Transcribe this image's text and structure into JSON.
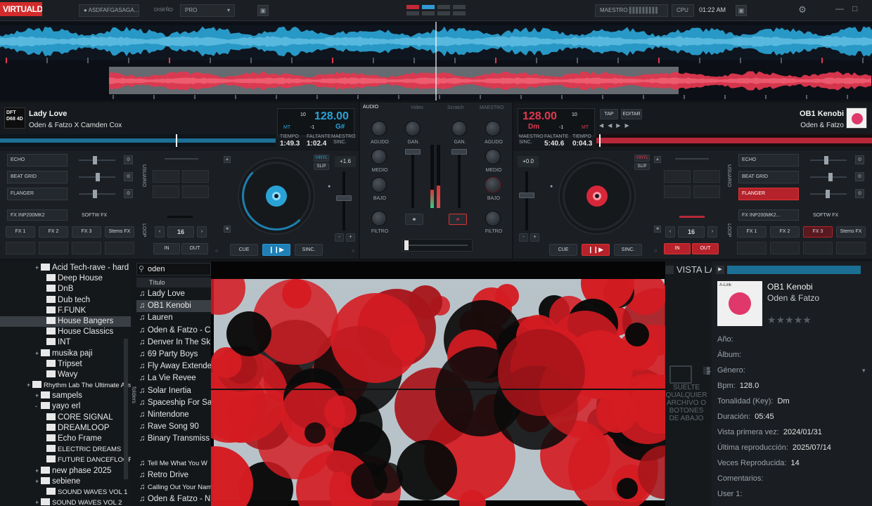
{
  "topbar": {
    "logo": "VIRTUALDJ",
    "user": "ASDFAFGASAGA...",
    "design_label": "DISEÑO",
    "design_value": "PRO",
    "master_label": "MAESTRO",
    "cpu_label": "CPU",
    "clock": "01:22 AM"
  },
  "deck_left": {
    "title": "Lady Love",
    "artist": "Oden & Fatzo X Camden Cox",
    "art_text": "DFT D68 4D",
    "key_num": "10",
    "bpm": "128.00",
    "key": "G#",
    "mt": "MT",
    "pitch_offset": "-1",
    "time_label": "TIEMPO",
    "remaining_label": "FALTANTE",
    "master_label": "MAESTRO",
    "elapsed": "1:49.3",
    "remaining": "1:02.4",
    "sync_label": "SINC.",
    "fx": [
      "ECHO",
      "BEAT GRID",
      "FLANGER"
    ],
    "fx_device": "FX INP200MK2",
    "softw_fx": "SOFTW FX",
    "fx_buttons": [
      "FX 1",
      "FX 2",
      "FX 3",
      "Stems FX"
    ],
    "loop_size": "16",
    "in_label": "IN",
    "out_label": "OUT",
    "cue": "CUE",
    "sync": "SINC.",
    "vinyl": "VINYL",
    "slip": "SLIP",
    "pitch": "+1.6",
    "pad_label": "USUARIO",
    "loop_label": "LOOP"
  },
  "deck_right": {
    "title": "OB1 Kenobi",
    "artist": "Oden & Fatzo",
    "key_num": "10",
    "bpm": "128.00",
    "key": "Dm",
    "mt": "MT",
    "pitch_offset": "-1",
    "time_label": "TIEMPO",
    "remaining_label": "FALTANTE",
    "master_label": "MAESTRO",
    "elapsed": "0:04.3",
    "remaining": "5:40.6",
    "sync_label": "SINC.",
    "tap": "TAP",
    "edit": "EDITAR",
    "fx": [
      "ECHO",
      "BEAT GRID",
      "FLANGER"
    ],
    "fx_device": "FX INP200MK2...",
    "softw_fx": "SOFTW FX",
    "fx_buttons": [
      "FX 1",
      "FX 2",
      "FX 3",
      "Stems FX"
    ],
    "loop_size": "16",
    "in_label": "IN",
    "out_label": "OUT",
    "cue": "CUE",
    "sync": "SINC.",
    "vinyl": "VINYL",
    "slip": "SLIP",
    "pitch": "+0.0",
    "pad_label": "USUARIO",
    "loop_label": "LOOP"
  },
  "mixer": {
    "tabs": [
      "AUDIO",
      "Video",
      "Scratch",
      "MAESTRO"
    ],
    "left_eq": [
      "AGUDO",
      "MEDIO",
      "BAJO",
      "FILTRO"
    ],
    "right_eq": [
      "AGUDO",
      "MEDIO",
      "BAJO",
      "FILTRO"
    ],
    "gain": "GAN."
  },
  "browser": {
    "folders": [
      {
        "name": "Acid Tech-rave - hard",
        "exp": "+"
      },
      {
        "name": "Deep House",
        "exp": ""
      },
      {
        "name": "DnB",
        "exp": ""
      },
      {
        "name": "Dub tech",
        "exp": ""
      },
      {
        "name": "F.FUNK",
        "exp": ""
      },
      {
        "name": "House Bangers",
        "exp": "",
        "selected": true
      },
      {
        "name": "House Classics",
        "exp": ""
      },
      {
        "name": "INT",
        "exp": ""
      },
      {
        "name": "musika paji",
        "exp": "+"
      },
      {
        "name": "Tripset",
        "exp": ""
      },
      {
        "name": "Wavy",
        "exp": ""
      },
      {
        "name": "Rhythm Lab The Ultimate Am",
        "exp": "+",
        "small": true
      },
      {
        "name": "sampels",
        "exp": "+"
      },
      {
        "name": "yayo erl",
        "exp": "-"
      },
      {
        "name": "CORE SIGNAL",
        "exp": ""
      },
      {
        "name": "DREAMLOOP",
        "exp": ""
      },
      {
        "name": "Echo Frame",
        "exp": ""
      },
      {
        "name": "ELECTRIC DREAMS",
        "exp": "",
        "small": true
      },
      {
        "name": "FUTURE DANCEFLOOR",
        "exp": "",
        "small": true
      },
      {
        "name": "new phase 2025",
        "exp": "+"
      },
      {
        "name": "sebiene",
        "exp": "+"
      },
      {
        "name": "SOUND WAVES VOL 1",
        "exp": "",
        "small": true
      },
      {
        "name": "SOUND WAVES VOL 2",
        "exp": "+",
        "small": true
      }
    ],
    "search": "oden",
    "column_title": "Título",
    "folders_tab": "folders",
    "tracks": [
      "Lady Love",
      "OB1 Kenobi",
      "Lauren",
      "Oden & Fatzo - C",
      "Denver In The Sk",
      "69 Party Boys",
      "Fly Away Extende",
      "La Vie Revee",
      "Solar Inertia",
      "Spaceship For Sa",
      "Nintendone",
      "Rave Song 90",
      "Binary Transmiss",
      "",
      "Tell Me What You W",
      "Retro Drive",
      "Calling Out Your Name (I",
      "Oden & Fatzo - N"
    ],
    "vista": "VISTA LA",
    "drop_hint": "SUELTE QUALQUIER ARCHIVO O BOTONES DE ABAJO",
    "info_tab": "info"
  },
  "info": {
    "title": "OB1 Kenobi",
    "artist": "Oden & Fatzo",
    "art_label": "A-Link",
    "fields": [
      {
        "label": "Año:",
        "value": ""
      },
      {
        "label": "Álbum:",
        "value": ""
      },
      {
        "label": "Género:",
        "value": ""
      },
      {
        "label": "Bpm:",
        "value": "128.0"
      },
      {
        "label": "Tonalidad (Key):",
        "value": "Dm"
      },
      {
        "label": "Duración:",
        "value": "05:45"
      },
      {
        "label": "Vista primera vez:",
        "value": "2024/01/31"
      },
      {
        "label": "Última reproducción:",
        "value": "2025/07/14"
      },
      {
        "label": "Veces Reproducida:",
        "value": "14"
      },
      {
        "label": "Comentarios:",
        "value": ""
      },
      {
        "label": "User 1:",
        "value": ""
      }
    ]
  },
  "colors": {
    "left_accent": "#29a3d6",
    "right_accent": "#d6283a"
  }
}
